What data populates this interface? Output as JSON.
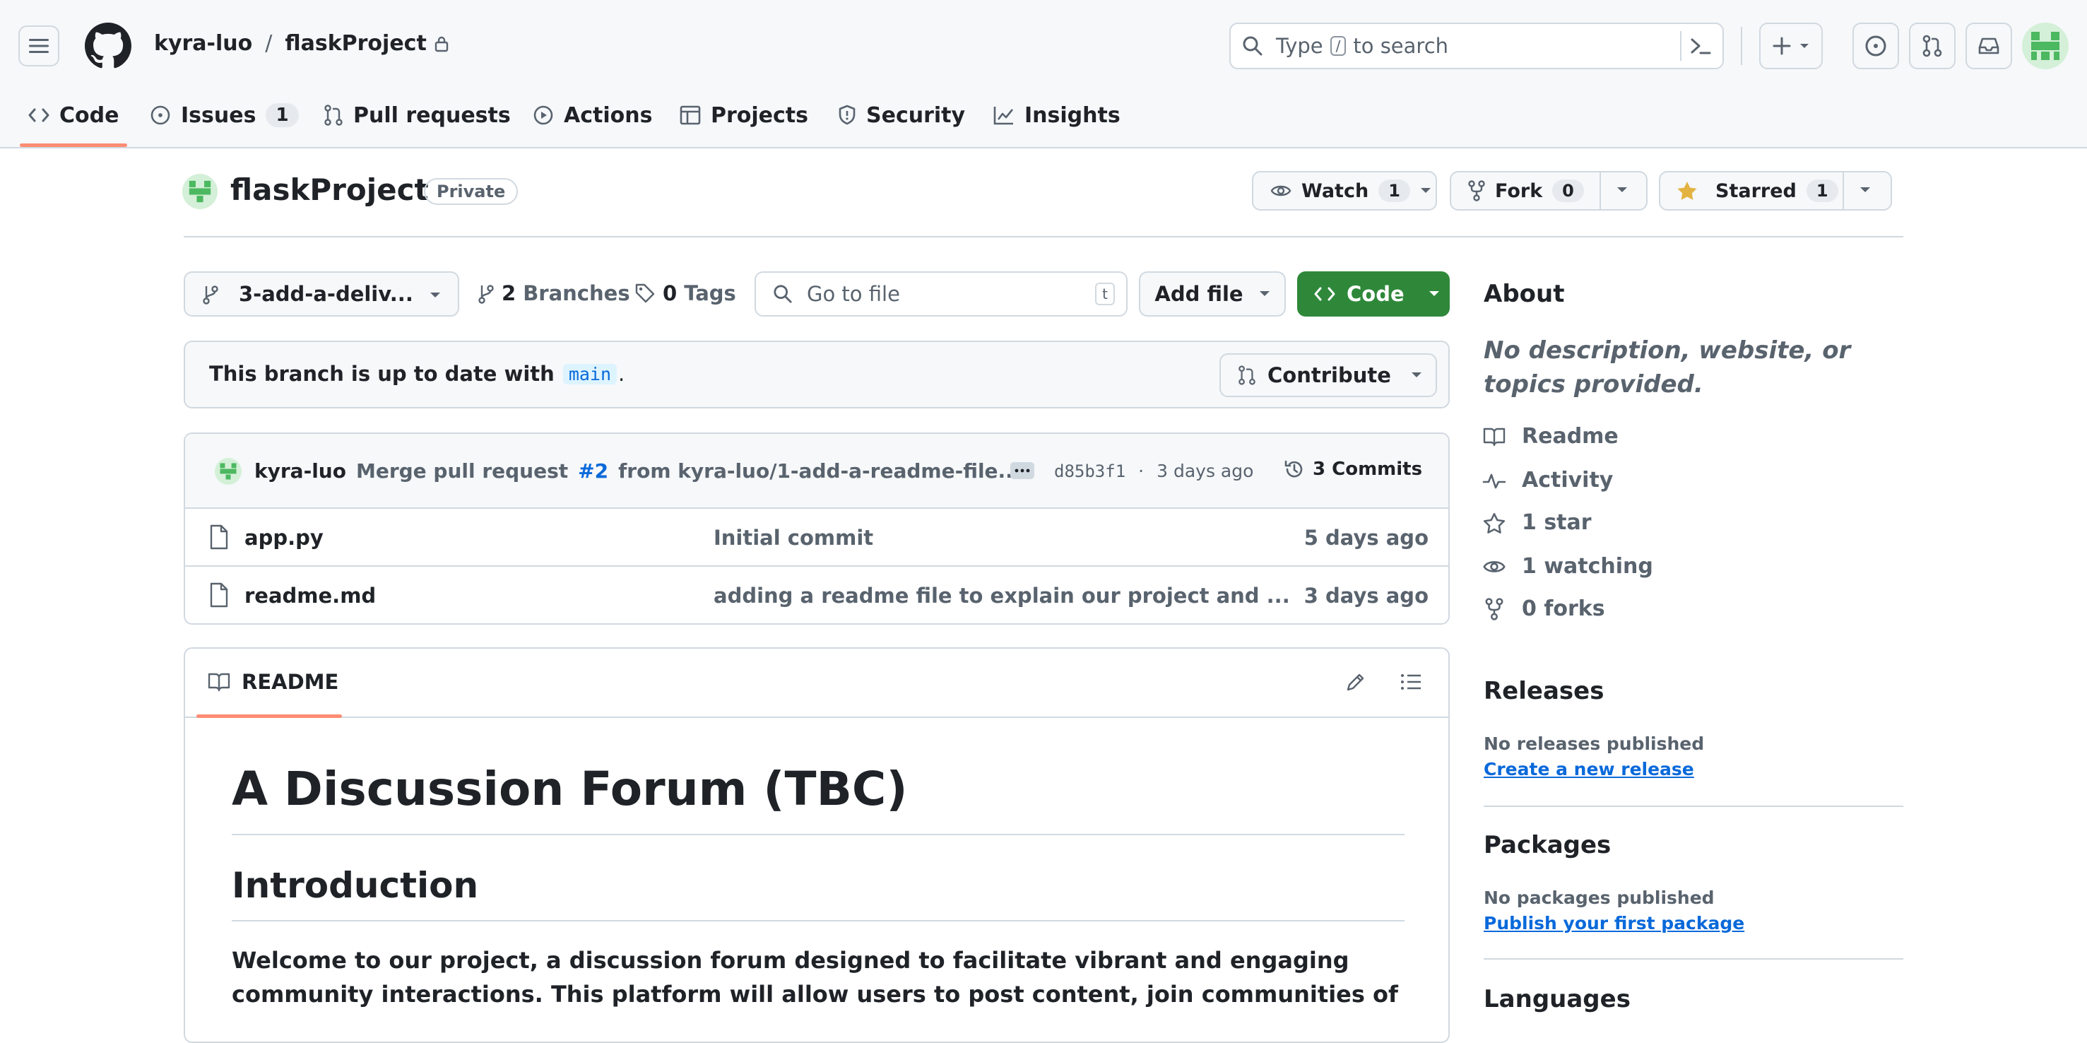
{
  "header": {
    "owner": "kyra-luo",
    "separator": "/",
    "repo": "flaskProject",
    "search_prefix": "Type",
    "search_key": "/",
    "search_suffix": "to search"
  },
  "tabs": [
    {
      "label": "Code",
      "icon": "code-icon"
    },
    {
      "label": "Issues",
      "count": "1",
      "icon": "issue-icon"
    },
    {
      "label": "Pull requests",
      "icon": "pull-request-icon"
    },
    {
      "label": "Actions",
      "icon": "play-icon"
    },
    {
      "label": "Projects",
      "icon": "table-icon"
    },
    {
      "label": "Security",
      "icon": "shield-icon"
    },
    {
      "label": "Insights",
      "icon": "graph-icon"
    }
  ],
  "repo_head": {
    "name": "flaskProject",
    "visibility": "Private",
    "watch_label": "Watch",
    "watch_count": "1",
    "fork_label": "Fork",
    "fork_count": "0",
    "star_label": "Starred",
    "star_count": "1"
  },
  "toolbar": {
    "branch": "3-add-a-deliv...",
    "branches_count": "2",
    "branches_label": "Branches",
    "tags_count": "0",
    "tags_label": "Tags",
    "go_to_file": "Go to file",
    "go_to_file_key": "t",
    "add_file": "Add file",
    "code": "Code"
  },
  "branch_status": {
    "text": "This branch is up to date with",
    "base": "main",
    "period": ".",
    "contribute": "Contribute"
  },
  "commit": {
    "author": "kyra-luo",
    "message_prefix": "Merge pull request",
    "pr": "#2",
    "message_suffix": "from kyra-luo/1-add-a-readme-file...",
    "sha": "d85b3f1",
    "dot": "·",
    "time": "3 days ago",
    "commits_label": "3 Commits"
  },
  "files": [
    {
      "name": "app.py",
      "message": "Initial commit",
      "time": "5 days ago"
    },
    {
      "name": "readme.md",
      "message": "adding a readme file to explain our project and ...",
      "time": "3 days ago"
    }
  ],
  "readme": {
    "tab_label": "README",
    "h1": "A Discussion Forum (TBC)",
    "h2": "Introduction",
    "line1": "Welcome to our project, a discussion forum designed to facilitate vibrant and engaging",
    "line2": "community interactions. This platform will allow users to post content, join communities of"
  },
  "about": {
    "title": "About",
    "description": "No description, website, or topics provided.",
    "items": [
      {
        "label": "Readme",
        "icon": "book-icon"
      },
      {
        "label": "Activity",
        "icon": "pulse-icon"
      },
      {
        "label": "1 star",
        "icon": "star-icon"
      },
      {
        "label": "1 watching",
        "icon": "eye-icon"
      },
      {
        "label": "0 forks",
        "icon": "fork-icon"
      }
    ]
  },
  "releases": {
    "title": "Releases",
    "empty": "No releases published",
    "link": "Create a new release"
  },
  "packages": {
    "title": "Packages",
    "empty": "No packages published",
    "link": "Publish your first package"
  },
  "languages": {
    "title": "Languages"
  },
  "colors": {
    "accent_green": "#2f883a",
    "link_blue": "#0969da",
    "tab_underline": "#fd8c73",
    "star_yellow": "#e3b341"
  }
}
